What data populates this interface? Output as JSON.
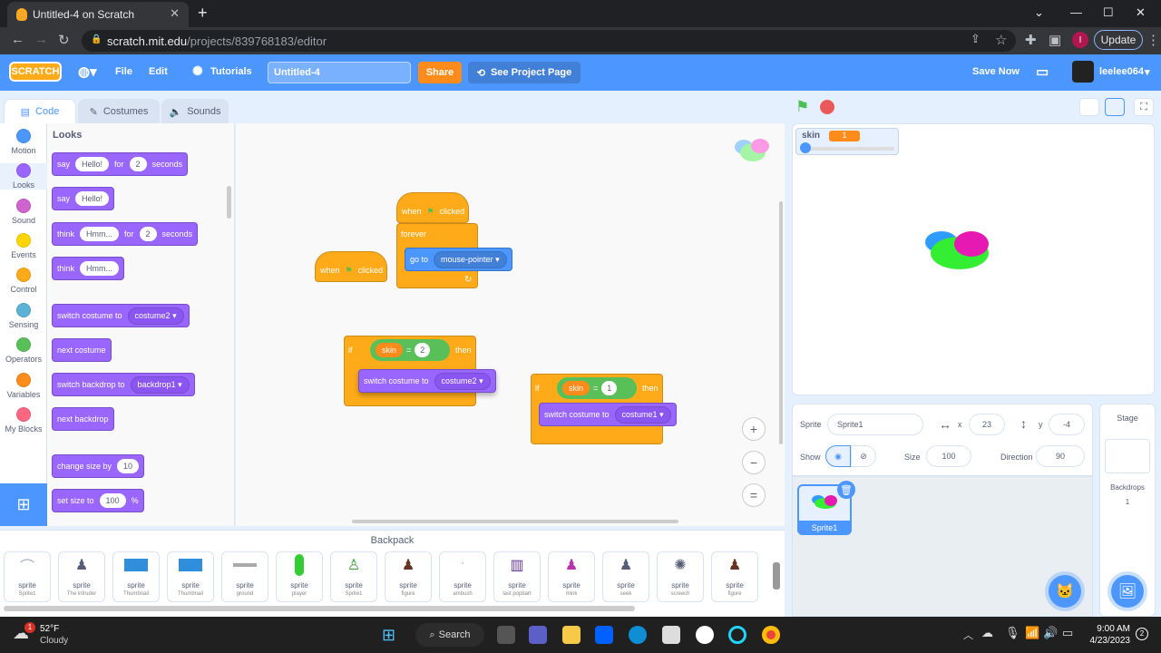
{
  "browser": {
    "tab_title": "Untitled-4 on Scratch",
    "url_host": "scratch.mit.edu",
    "url_path": "/projects/839768183/editor",
    "update_label": "Update",
    "new_tab": "+",
    "profile_initial": "I"
  },
  "menu": {
    "logo": "SCRATCH",
    "file": "File",
    "edit": "Edit",
    "tutorials": "Tutorials",
    "project_title": "Untitled-4",
    "share": "Share",
    "see_project_page": "See Project Page",
    "save_now": "Save Now",
    "username": "leelee064"
  },
  "editor_tabs": [
    "Code",
    "Costumes",
    "Sounds"
  ],
  "categories": [
    {
      "label": "Motion",
      "color": "#4c97ff"
    },
    {
      "label": "Looks",
      "color": "#9966ff"
    },
    {
      "label": "Sound",
      "color": "#cf63cf"
    },
    {
      "label": "Events",
      "color": "#ffd500"
    },
    {
      "label": "Control",
      "color": "#ffab19"
    },
    {
      "label": "Sensing",
      "color": "#5cb1d6"
    },
    {
      "label": "Operators",
      "color": "#59c059"
    },
    {
      "label": "Variables",
      "color": "#ff8c1a"
    },
    {
      "label": "My Blocks",
      "color": "#ff6680"
    }
  ],
  "palette": {
    "heading": "Looks",
    "say_for": {
      "say": "say",
      "text": "Hello!",
      "for": "for",
      "secs": "2",
      "seconds": "seconds"
    },
    "say": {
      "say": "say",
      "text": "Hello!"
    },
    "think_for": {
      "think": "think",
      "text": "Hmm...",
      "for": "for",
      "secs": "2",
      "seconds": "seconds"
    },
    "think": {
      "think": "think",
      "text": "Hmm..."
    },
    "switch_costume": {
      "label": "switch costume to",
      "value": "costume2"
    },
    "next_costume": "next costume",
    "switch_backdrop": {
      "label": "switch backdrop to",
      "value": "backdrop1"
    },
    "next_backdrop": "next backdrop",
    "change_size": {
      "label": "change size by",
      "value": "10"
    },
    "set_size": {
      "label": "set size to",
      "value": "100",
      "unit": "%"
    }
  },
  "scripts": {
    "hat1": {
      "when": "when",
      "clicked": "clicked"
    },
    "forever": "forever",
    "goto": {
      "label": "go to",
      "value": "mouse-pointer"
    },
    "hat2": {
      "when": "when",
      "clicked": "clicked"
    },
    "if1": {
      "if": "if",
      "var": "skin",
      "eq": "=",
      "val": "2",
      "then": "then",
      "costume_label": "switch costume to",
      "costume": "costume2"
    },
    "if2": {
      "if": "if",
      "var": "skin",
      "eq": "=",
      "val": "1",
      "then": "then",
      "costume_label": "switch costume to",
      "costume": "costume1"
    }
  },
  "zoom": {
    "in": "+",
    "out": "−",
    "reset": "="
  },
  "stage": {
    "monitor_name": "skin",
    "monitor_value": "1"
  },
  "sprite_info": {
    "sprite_label": "Sprite",
    "sprite_name": "Sprite1",
    "x_label": "x",
    "x": "23",
    "y_label": "y",
    "y": "-4",
    "show_label": "Show",
    "size_label": "Size",
    "size": "100",
    "direction_label": "Direction",
    "direction": "90"
  },
  "sprites": [
    {
      "name": "Sprite1"
    }
  ],
  "stage_panel": {
    "title": "Stage",
    "backdrops_label": "Backdrops",
    "backdrops_count": "1"
  },
  "backpack": {
    "title": "Backpack",
    "items": [
      {
        "type": "sprite",
        "name": "Sprite1"
      },
      {
        "type": "sprite",
        "name": "The intruder"
      },
      {
        "type": "sprite",
        "name": "Thumbnail"
      },
      {
        "type": "sprite",
        "name": "Thumbnail"
      },
      {
        "type": "sprite",
        "name": "ground"
      },
      {
        "type": "sprite",
        "name": "player"
      },
      {
        "type": "sprite",
        "name": "Sprite1"
      },
      {
        "type": "sprite",
        "name": "figure"
      },
      {
        "type": "sprite",
        "name": "ambush"
      },
      {
        "type": "sprite",
        "name": "last popbart"
      },
      {
        "type": "sprite",
        "name": "mink"
      },
      {
        "type": "sprite",
        "name": "seek"
      },
      {
        "type": "sprite",
        "name": "screech"
      },
      {
        "type": "sprite",
        "name": "figure"
      }
    ]
  },
  "taskbar": {
    "weather_temp": "52°F",
    "weather_desc": "Cloudy",
    "weather_badge": "1",
    "search": "Search",
    "time": "9:00 AM",
    "date": "4/23/2023"
  }
}
